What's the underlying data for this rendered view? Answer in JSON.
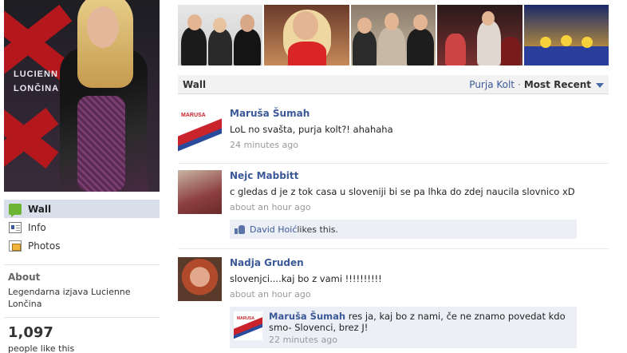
{
  "profile": {
    "photo_text": [
      "LUCIENN",
      "LONČINA"
    ]
  },
  "nav": [
    {
      "label": "Wall",
      "icon": "wall-icon",
      "active": true
    },
    {
      "label": "Info",
      "icon": "info-icon",
      "active": false
    },
    {
      "label": "Photos",
      "icon": "photos-icon",
      "active": false
    }
  ],
  "about": {
    "heading": "About",
    "text": "Legendarna izjava Lucienne Lončina"
  },
  "likes": {
    "count": "1,097",
    "label": "people like this"
  },
  "wall_bar": {
    "title": "Wall",
    "filter_link": "Purja Kolt",
    "separator": "·",
    "filter_selected": "Most Recent"
  },
  "stories": [
    {
      "author": "Maruša Šumah",
      "message": "LoL no svašta, purja kolt?! ahahaha",
      "time": "24 minutes ago"
    },
    {
      "author": "Nejc Mabbitt",
      "message": "c gledas d je z tok casa u sloveniji bi se pa lhka do zdej naucila slovnico xD",
      "time": "about an hour ago",
      "likes": {
        "liker": "David Hoić",
        "suffix": " likes this."
      }
    },
    {
      "author": "Nadja Gruden",
      "message": "slovenjci....kaj bo z vami !!!!!!!!!!",
      "time": "about an hour ago",
      "comment": {
        "author": "Maruša Šumah",
        "text": " res ja, kaj bo z nami, če ne znamo povedat kdo smo- Slovenci, brez J!",
        "time": "22 minutes ago"
      }
    }
  ],
  "colors": {
    "link": "#3b5998",
    "nav_active_bg": "#d8dfea",
    "feedback_bg": "#eceff5",
    "muted": "#999999"
  }
}
